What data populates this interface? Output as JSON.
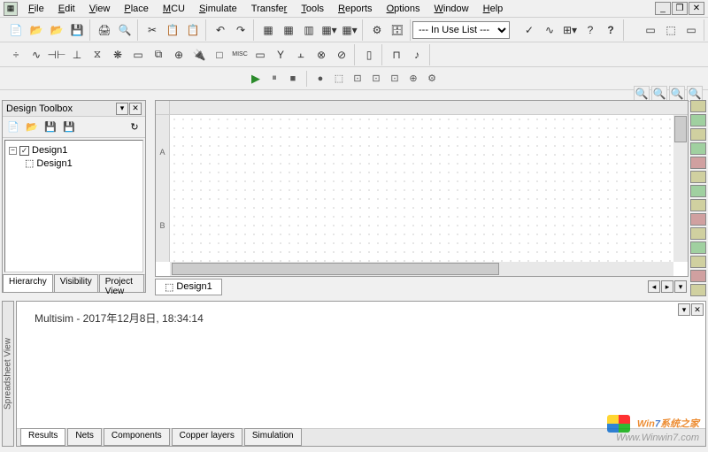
{
  "menu": {
    "items": [
      "File",
      "Edit",
      "View",
      "Place",
      "MCU",
      "Simulate",
      "Transfer",
      "Tools",
      "Reports",
      "Options",
      "Window",
      "Help"
    ]
  },
  "toolbar1_groups": [
    [
      "📄",
      "📂",
      "📂",
      "💾"
    ],
    [
      "🖨",
      "🔍"
    ],
    [
      "✂",
      "📋",
      "📋"
    ],
    [
      "↶",
      "↷"
    ]
  ],
  "toolbar1_right_groups": [
    [
      "▦",
      "▦",
      "▥",
      "▦",
      "▾",
      "▦",
      "▾"
    ],
    [
      "⚙"
    ]
  ],
  "in_use_list": "--- In Use List ---",
  "toolbar1_far_right": [
    "✓",
    "∿",
    "⊞",
    "▾",
    "?",
    "❓"
  ],
  "toolbar1_box": [
    "▭",
    "⬚",
    "▭"
  ],
  "toolbar2": [
    "÷",
    "∿",
    "⊣⊢",
    "⊥",
    "⧖",
    "❋",
    "▭",
    "⧉",
    "⊕",
    "🔌",
    "□",
    "MISC",
    "▭",
    "Y",
    "⫠",
    "⊗",
    "⊘"
  ],
  "toolbar2_g2": [
    "▯",
    "⊓",
    "♪"
  ],
  "sim_controls": [
    "▶",
    "⏸",
    "■",
    "●",
    "⬚",
    "⊡",
    "⊡",
    "⊡",
    "⊕",
    "⚙"
  ],
  "zoom": [
    "🔍",
    "🔍",
    "🔍",
    "🔍"
  ],
  "design_toolbox": {
    "title": "Design Toolbox",
    "toolbar": [
      "📄",
      "📂",
      "💾",
      "💾",
      "",
      "↻"
    ],
    "tree_root": "Design1",
    "tree_child": "Design1",
    "tabs": [
      "Hierarchy",
      "Visibility",
      "Project View"
    ]
  },
  "ruler_v_labels": [
    "A",
    "B"
  ],
  "canvas_tab": "Design1",
  "right_instruments_count": 16,
  "spreadsheet": {
    "label": "Spreadsheet View",
    "message": "Multisim  -  2017年12月8日, 18:34:14",
    "tabs": [
      "Results",
      "Nets",
      "Components",
      "Copper layers",
      "Simulation"
    ]
  },
  "watermark": {
    "brand_prefix": "Win",
    "brand_seven": "7",
    "brand_suffix": "系统之家",
    "url": "Www.Winwin7.com"
  }
}
